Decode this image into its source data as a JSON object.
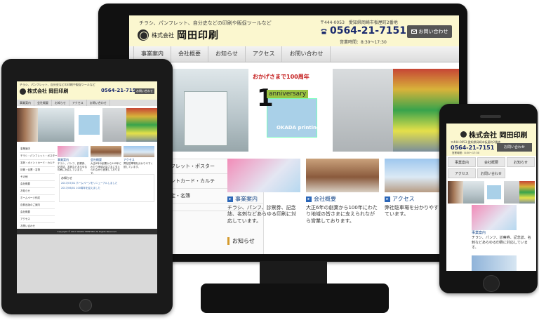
{
  "desktop": {
    "tagline": "チラシ、パンフレット、自分史などの印刷や販促ツールなど",
    "company_small": "株式会社",
    "company_name": "岡田印刷",
    "postal_address": "〒444-0053　愛知県岡崎市板屋町2番地",
    "phone": "0564-21-7151",
    "hours": "営業時間：8:30〜17:30",
    "contact_button": "お問い合わせ",
    "nav": [
      "事業案内",
      "会社概要",
      "お知らせ",
      "アクセス",
      "お問い合わせ"
    ],
    "anniversary": {
      "heading": "おかげさまで100周年",
      "number": "1",
      "word": "anniversary",
      "brand": "OKADA printing"
    },
    "side_menu": [
      "フレット・ポスター",
      "ントカード・カルテ",
      "定・名簿",
      ""
    ],
    "cards": [
      {
        "title": "事業案内",
        "text": "チラシ、パンフ、診察券、記念誌、名刺などあらゆる印刷に対応しています。"
      },
      {
        "title": "会社概要",
        "text": "大正6年の創業から100年にわたり地域の皆さまに支えられながら営業しております。"
      },
      {
        "title": "アクセス",
        "text": "弊社駐車場を分かりやすく説しています。"
      }
    ],
    "news_heading": "お知らせ"
  },
  "tablet": {
    "tagline": "チラシ、パンフレット、自分史などの印刷や販促ツールなど",
    "company_name": "株式会社 岡田印刷",
    "phone": "0564-21-7151",
    "contact_button": "お問い合わせ",
    "nav": [
      "事業案内",
      "会社概要",
      "お知らせ",
      "アクセス",
      "お問い合わせ"
    ],
    "side_menu": [
      "事業案内",
      "チラシ・パンフレット・ポスター",
      "名刺・ポイントカード・カルテ",
      "封筒・伝票・名簿",
      "その他",
      "会社概要",
      "お知らせ",
      "ホームページ作成",
      "自費出版のご案内",
      "会社概要",
      "アクセス",
      "お問い合わせ"
    ],
    "cards": [
      {
        "title": "事業案内",
        "text": "チラシ、パンフ、診察券、記念誌、名刺などあらゆる印刷に対応しています。"
      },
      {
        "title": "会社概要",
        "text": "大正6年の創業から100年にわたり地域の皆さまに支えられながら営業しております。"
      },
      {
        "title": "アクセス",
        "text": "弊社駐車場を分かりやすく説しています。"
      }
    ],
    "news_heading": "お知らせ",
    "news_items": [
      "2017/07/01 ホームページをリニューアルしました",
      "2017/06/01 100周年を迎えました"
    ],
    "footer": "Copyright © 2017 OKADA PRINTING All Rights Reserved."
  },
  "phone": {
    "company_name": "株式会社 岡田印刷",
    "postal_address": "〒444-0053 愛知県岡崎市板屋町2番地",
    "phone": "0564-21-7151",
    "hours": "営業時間：8:30〜17:30",
    "contact_button": "お問い合わせ",
    "nav": [
      "事業案内",
      "会社概要",
      "お知らせ",
      "アクセス",
      "お問い合わせ"
    ],
    "card_title": "事業案内",
    "card_text": "チラシ、パンフ、診察券、記念誌、名刺などあらゆる印刷に対応しています。"
  },
  "colors": {
    "header_bg": "#fbf7cf",
    "phone_blue": "#1a2a6e",
    "link_blue": "#1a4a8a",
    "accent_orange": "#d49a2c",
    "device_black": "#111111"
  }
}
